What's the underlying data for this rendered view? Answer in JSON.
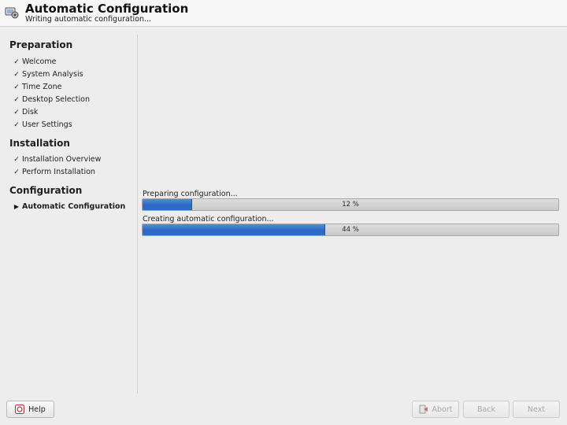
{
  "header": {
    "title": "Automatic Configuration",
    "subtitle": "Writing automatic configuration..."
  },
  "sidebar": {
    "sections": [
      {
        "title": "Preparation",
        "steps": [
          "Welcome",
          "System Analysis",
          "Time Zone",
          "Desktop Selection",
          "Disk",
          "User Settings"
        ]
      },
      {
        "title": "Installation",
        "steps": [
          "Installation Overview",
          "Perform Installation"
        ]
      },
      {
        "title": "Configuration",
        "steps": [
          "Automatic Configuration"
        ]
      }
    ],
    "done_mark": "✓",
    "current_mark": "▶"
  },
  "progress": [
    {
      "label": "Preparing configuration...",
      "percent": 12,
      "text": "12 %"
    },
    {
      "label": "Creating automatic configuration...",
      "percent": 44,
      "text": "44 %"
    }
  ],
  "buttons": {
    "help": "Help",
    "abort": "Abort",
    "back": "Back",
    "next": "Next"
  },
  "colors": {
    "progress_fill": "#2f6fc8",
    "background": "#ededed"
  }
}
